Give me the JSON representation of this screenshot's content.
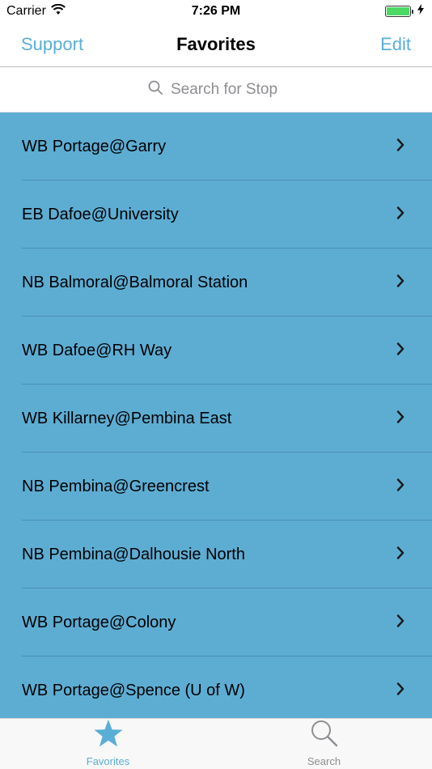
{
  "status": {
    "carrier": "Carrier",
    "time": "7:26 PM",
    "battery_level": 1.0
  },
  "nav": {
    "left_button": "Support",
    "title": "Favorites",
    "right_button": "Edit"
  },
  "search": {
    "placeholder": "Search for Stop"
  },
  "favorites": [
    "WB Portage@Garry",
    "EB Dafoe@University",
    "NB Balmoral@Balmoral Station",
    "WB Dafoe@RH Way",
    "WB Killarney@Pembina East",
    "NB Pembina@Greencrest",
    "NB Pembina@Dalhousie North",
    "WB Portage@Colony",
    "WB Portage@Spence (U of W)"
  ],
  "tabs": {
    "favorites_label": "Favorites",
    "search_label": "Search"
  },
  "colors": {
    "accent": "#5aaed6",
    "list_background": "#5dadd3"
  },
  "icons": {
    "wifi": "wifi-icon",
    "charging": "bolt-icon",
    "search": "search-icon",
    "chevron": "chevron-right-icon",
    "favorites_tab": "star-icon",
    "search_tab": "search-icon"
  }
}
